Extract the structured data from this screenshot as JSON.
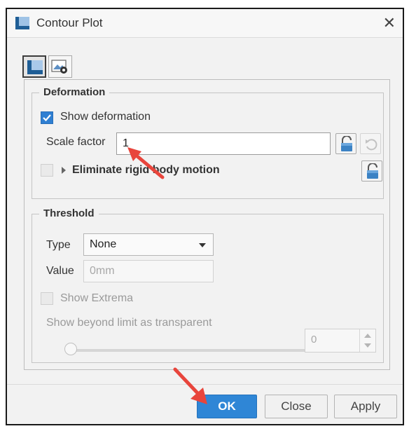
{
  "window": {
    "title": "Contour Plot",
    "close_glyph": "✕"
  },
  "tabs": [
    {
      "icon": "contour-tab-icon",
      "active": true
    },
    {
      "icon": "settings-tab-icon",
      "active": false
    }
  ],
  "deformation": {
    "legend": "Deformation",
    "show_deformation": {
      "label": "Show deformation",
      "checked": true
    },
    "scale_factor": {
      "label": "Scale factor",
      "value": "1"
    },
    "eliminate_rigid": {
      "label": "Eliminate rigid body motion",
      "checked": false
    }
  },
  "threshold": {
    "legend": "Threshold",
    "type_label": "Type",
    "type_value": "None",
    "value_label": "Value",
    "value_placeholder": "0mm",
    "show_extrema": {
      "label": "Show Extrema",
      "checked": false
    },
    "beyond_limit_label": "Show beyond limit as transparent",
    "slider_value": "0"
  },
  "buttons": {
    "ok": "OK",
    "close": "Close",
    "apply": "Apply"
  },
  "colors": {
    "accent": "#2f86d6",
    "annotation_arrow": "#e8453c"
  }
}
